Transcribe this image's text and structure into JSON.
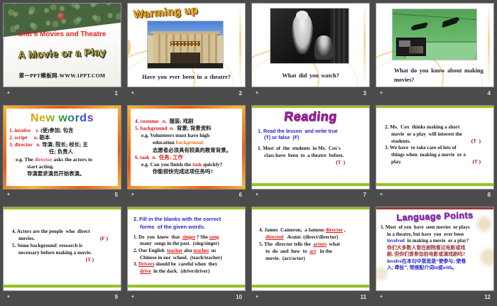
{
  "canvas": {
    "background": "#4b4b4b",
    "accent_green": "#95c11f",
    "flame_border": "#e85a19"
  },
  "footer_icon": "✦",
  "slides": [
    {
      "number": "1",
      "unit": "Unit 6  Movies and Theatre",
      "title": "A Movie or a Play",
      "site": "第一PPT模板网-WWW.1PPT.COM"
    },
    {
      "number": "2",
      "wordart": "Warming up",
      "caption": "Have  you  ever  been  in a theatre?"
    },
    {
      "number": "3",
      "caption": "What  did  you  watch?"
    },
    {
      "number": "4",
      "caption_line1": "What  do  you  know  about  making",
      "caption_line2": "movies?"
    },
    {
      "number": "5",
      "wordart": "New words",
      "lines": [
        {
          "parts": [
            {
              "t": "1. involve",
              "cls": "red"
            },
            {
              "t": "    v. ",
              "cls": "red i"
            },
            {
              "t": "(使)参加; 包含"
            }
          ]
        },
        {
          "parts": [
            {
              "t": "2. script",
              "cls": "red"
            },
            {
              "t": "     n. ",
              "cls": "red i"
            },
            {
              "t": "剧本"
            }
          ]
        },
        {
          "parts": [
            {
              "t": "3. director",
              "cls": "red"
            },
            {
              "t": "   n. ",
              "cls": "red i"
            },
            {
              "t": "导演; 院长; 校长; 主"
            }
          ]
        },
        {
          "cls": "ind3",
          "parts": [
            {
              "t": "任; 负责人"
            }
          ]
        },
        {
          "cls": "ind1",
          "parts": [
            {
              "t": "e.g. The "
            },
            {
              "t": "director",
              "cls": "mag"
            },
            {
              "t": " asks the actors to"
            }
          ]
        },
        {
          "cls": "ind2",
          "parts": [
            {
              "t": "start acting."
            }
          ]
        },
        {
          "cls": "ind2",
          "parts": [
            {
              "t": "导演要求演员开始表演。"
            }
          ]
        }
      ]
    },
    {
      "number": "6",
      "lines": [
        {
          "parts": [
            {
              "t": "4. costume",
              "cls": "red"
            },
            {
              "t": "   n.  ",
              "cls": "red i"
            },
            {
              "t": "服装; 戏剧"
            }
          ]
        },
        {
          "parts": [
            {
              "t": "5. background",
              "cls": "red"
            },
            {
              "t": "  n.  ",
              "cls": "red i"
            },
            {
              "t": "背景; 背景资料"
            }
          ]
        },
        {
          "cls": "ind1",
          "parts": [
            {
              "t": "e.g. Volunteers must have high"
            }
          ]
        },
        {
          "cls": "ind2",
          "parts": [
            {
              "t": "education "
            },
            {
              "t": "background.",
              "cls": "org"
            }
          ]
        },
        {
          "cls": "ind2",
          "parts": [
            {
              "t": "志愿者必须具有较高的教育背景。"
            }
          ]
        },
        {
          "parts": [
            {
              "t": "6. task",
              "cls": "red"
            },
            {
              "t": "  n.  ",
              "cls": "red i"
            },
            {
              "t": "任务; 工作",
              "cls": "red"
            }
          ]
        },
        {
          "cls": "ind1",
          "parts": [
            {
              "t": "e.g. Can you finish the "
            },
            {
              "t": "task",
              "cls": "red"
            },
            {
              "t": " quickly?"
            }
          ]
        },
        {
          "cls": "ind2",
          "parts": [
            {
              "t": "你能很快完成这项任务吗?"
            }
          ]
        }
      ]
    },
    {
      "number": "7",
      "wordart": "Reading",
      "lines": [
        {
          "cls": "sans",
          "parts": [
            {
              "t": "1. Read the lesson  and write true",
              "cls": "blue"
            }
          ]
        },
        {
          "cls": "sans ind1",
          "parts": [
            {
              "t": "(T) or false  (F)",
              "cls": "blue"
            }
          ]
        },
        {
          "cls": "gap",
          "parts": [
            {
              "t": "1. Most  of  the  students  in Ms.  Cox's"
            }
          ]
        },
        {
          "cls": "ind1",
          "parts": [
            {
              "t": "class have  been  to  a theatre  before."
            }
          ]
        },
        {
          "cls": "right pr",
          "parts": [
            {
              "t": "("
            },
            {
              "t": "T",
              "cls": "red"
            },
            {
              "t": "  )"
            }
          ]
        }
      ]
    },
    {
      "number": "8",
      "lines": [
        {
          "parts": [
            {
              "t": "2. Ms.  Cox  thinks making a short"
            }
          ]
        },
        {
          "cls": "ind1",
          "parts": [
            {
              "t": "movie  or a play  will interest the"
            }
          ]
        },
        {
          "cls": "flex ind1",
          "parts": [
            {
              "t": "students."
            },
            {
              "t": "(",
              "cls": "push"
            },
            {
              "t": "T",
              "cls": "red"
            },
            {
              "t": "  )"
            }
          ]
        },
        {
          "parts": [
            {
              "t": "3. We have  to take care of lots of"
            }
          ]
        },
        {
          "cls": "ind1",
          "parts": [
            {
              "t": "things when  making a movie  or a"
            }
          ]
        },
        {
          "cls": "flex ind1",
          "parts": [
            {
              "t": "play."
            },
            {
              "t": "(",
              "cls": "push"
            },
            {
              "t": "T",
              "cls": "red"
            },
            {
              "t": " )"
            }
          ]
        }
      ]
    },
    {
      "number": "9",
      "lines": [
        {
          "parts": [
            {
              "t": "4. Actors are the people  who  direct"
            }
          ]
        },
        {
          "cls": "flex ind1",
          "parts": [
            {
              "t": "movies."
            },
            {
              "t": "(",
              "cls": "push"
            },
            {
              "t": "F",
              "cls": "red"
            },
            {
              "t": " )"
            }
          ]
        },
        {
          "parts": [
            {
              "t": "5. Some background  research is"
            }
          ]
        },
        {
          "cls": "ind1",
          "parts": [
            {
              "t": "necessary before making a movie."
            }
          ]
        },
        {
          "cls": "right pr2",
          "parts": [
            {
              "t": "("
            },
            {
              "t": "T",
              "cls": "red"
            },
            {
              "t": " )"
            }
          ]
        }
      ]
    },
    {
      "number": "10",
      "lines": [
        {
          "cls": "sans",
          "parts": [
            {
              "t": "2. Fill in the blanks with the correct",
              "cls": "blue"
            }
          ]
        },
        {
          "cls": "sans ind1",
          "parts": [
            {
              "t": "forms  of the given words.",
              "cls": "blue"
            }
          ]
        },
        {
          "cls": "gap",
          "parts": [
            {
              "t": "1. Do  you  know  that  "
            },
            {
              "t": "singer",
              "cls": "red u"
            },
            {
              "t": " ? She "
            },
            {
              "t": "sang",
              "cls": "red u"
            }
          ]
        },
        {
          "cls": "ind1",
          "parts": [
            {
              "t": "many  songs in the past.  (sing/singer)"
            }
          ]
        },
        {
          "parts": [
            {
              "t": "2. Our English  "
            },
            {
              "t": "teacher",
              "cls": "red u"
            },
            {
              "t": " also "
            },
            {
              "t": "teaches",
              "cls": "red u"
            },
            {
              "t": "  us"
            }
          ]
        },
        {
          "cls": "ind1",
          "parts": [
            {
              "t": "Chinese in our  school.  (teach/teacher)"
            }
          ]
        },
        {
          "parts": [
            {
              "t": "3. "
            },
            {
              "t": "Drivers",
              "cls": "red u"
            },
            {
              "t": " should be  careful when  they"
            }
          ]
        },
        {
          "cls": "ind1",
          "parts": [
            {
              "t": "drive",
              "cls": "red u"
            },
            {
              "t": "  in the dark.  (drive/driver)"
            }
          ]
        }
      ]
    },
    {
      "number": "11",
      "lines": [
        {
          "parts": [
            {
              "t": "4. James  Cameron,  a famous "
            },
            {
              "t": "director",
              "cls": "red u"
            },
            {
              "t": " ,"
            }
          ]
        },
        {
          "cls": "ind1",
          "parts": [
            {
              "t": "directed",
              "cls": "red u"
            },
            {
              "t": "   "
            },
            {
              "t": "Avatar.",
              "cls": "i"
            },
            {
              "t": " (direct/director)"
            }
          ]
        },
        {
          "parts": [
            {
              "t": "5. The  director tells the  "
            },
            {
              "t": "actors",
              "cls": "red u"
            },
            {
              "t": "  what"
            }
          ]
        },
        {
          "cls": "ind1",
          "parts": [
            {
              "t": "to  do  and  how  to  "
            },
            {
              "t": "act",
              "cls": "red u"
            },
            {
              "t": "   in the"
            }
          ]
        },
        {
          "cls": "ind1",
          "parts": [
            {
              "t": "movie.  (act/actor)"
            }
          ]
        }
      ]
    },
    {
      "number": "12",
      "wordart": "Language Points",
      "lines": [
        {
          "parts": [
            {
              "t": "1. Most  of you  have  seen movies  or plays"
            }
          ]
        },
        {
          "cls": "ind1",
          "parts": [
            {
              "t": "in a theatre, but have  you  ever been"
            }
          ]
        },
        {
          "cls": "ind1",
          "parts": [
            {
              "t": "involved",
              "cls": "blue"
            },
            {
              "t": "  in making a movie  or a play?"
            }
          ]
        },
        {
          "cls": "ind1",
          "parts": [
            {
              "t": "你们大多数人曾在剧院看过电影或戏",
              "cls": "dred"
            }
          ]
        },
        {
          "cls": "ind1",
          "parts": [
            {
              "t": "剧, 但你们曾参加拍电影或演戏剧吗?",
              "cls": "dred"
            }
          ]
        },
        {
          "cls": "ind1",
          "parts": [
            {
              "t": "involve在本句中意思是“使参与; 使卷",
              "cls": "blue"
            }
          ]
        },
        {
          "cls": "ind1",
          "parts": [
            {
              "t": "入; 牵扯”, 常搭配介词in或with。",
              "cls": "blue"
            }
          ]
        }
      ]
    }
  ]
}
